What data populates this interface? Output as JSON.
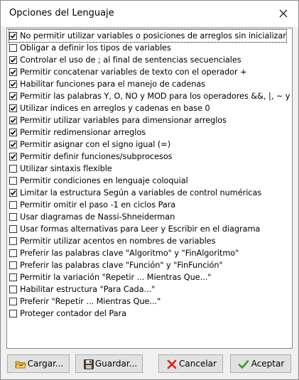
{
  "window": {
    "title": "Opciones del Lenguaje"
  },
  "options": [
    {
      "label": "No permitir utilizar variables o posiciones de arreglos sin inicializar",
      "checked": true
    },
    {
      "label": "Obligar a definir los tipos de variables",
      "checked": false
    },
    {
      "label": "Controlar el uso de ; al final de sentencias secuenciales",
      "checked": true
    },
    {
      "label": "Permitir concatenar variables de texto con el operador +",
      "checked": true
    },
    {
      "label": "Habilitar funciones para el manejo de cadenas",
      "checked": true
    },
    {
      "label": "Permitir las palabras Y, O, NO y MOD para los operadores &&, |, ~ y %",
      "checked": true
    },
    {
      "label": "Utilizar indices en arreglos y cadenas en base 0",
      "checked": true
    },
    {
      "label": "Permitir utilizar variables para dimensionar arreglos",
      "checked": true
    },
    {
      "label": "Permitir redimensionar arreglos",
      "checked": true
    },
    {
      "label": "Permitir asignar con el signo igual (=)",
      "checked": true
    },
    {
      "label": "Permitir definir funciones/subprocesos",
      "checked": true
    },
    {
      "label": "Utilizar sintaxis flexible",
      "checked": false
    },
    {
      "label": "Permitir condiciones en lenguaje coloquial",
      "checked": false
    },
    {
      "label": "Limitar la estructura Según a variables de control numéricas",
      "checked": true
    },
    {
      "label": "Permitir omitir el paso -1 en ciclos Para",
      "checked": false
    },
    {
      "label": "Usar diagramas de Nassi-Shneiderman",
      "checked": false
    },
    {
      "label": "Usar formas alternativas para Leer y Escribir en el diagrama",
      "checked": false
    },
    {
      "label": "Permitir utilizar acentos en nombres de variables",
      "checked": false
    },
    {
      "label": "Preferir las palabras clave \"Algoritmo\" y \"FinAlgoritmo\"",
      "checked": false
    },
    {
      "label": "Preferir las palabras clave \"Función\" y \"FinFunción\"",
      "checked": false
    },
    {
      "label": "Permitir la variación \"Repetir ... Mientras Que...\"",
      "checked": false
    },
    {
      "label": "Habilitar estructura \"Para Cada...\"",
      "checked": false
    },
    {
      "label": "Preferir \"Repetir ... Mientras Que...\"",
      "checked": false
    },
    {
      "label": "Proteger contador del Para",
      "checked": false
    }
  ],
  "buttons": {
    "load": {
      "label": "Cargar...",
      "icon": "folder-open-icon"
    },
    "save": {
      "label": "Guardar...",
      "icon": "floppy-disk-icon"
    },
    "cancel": {
      "label": "Cancelar",
      "icon": "red-x-icon"
    },
    "accept": {
      "label": "Aceptar",
      "icon": "green-check-icon"
    }
  },
  "colors": {
    "accept_check": "#2e9e1e",
    "cancel_x": "#e0201a",
    "folder": "#e8b730"
  }
}
